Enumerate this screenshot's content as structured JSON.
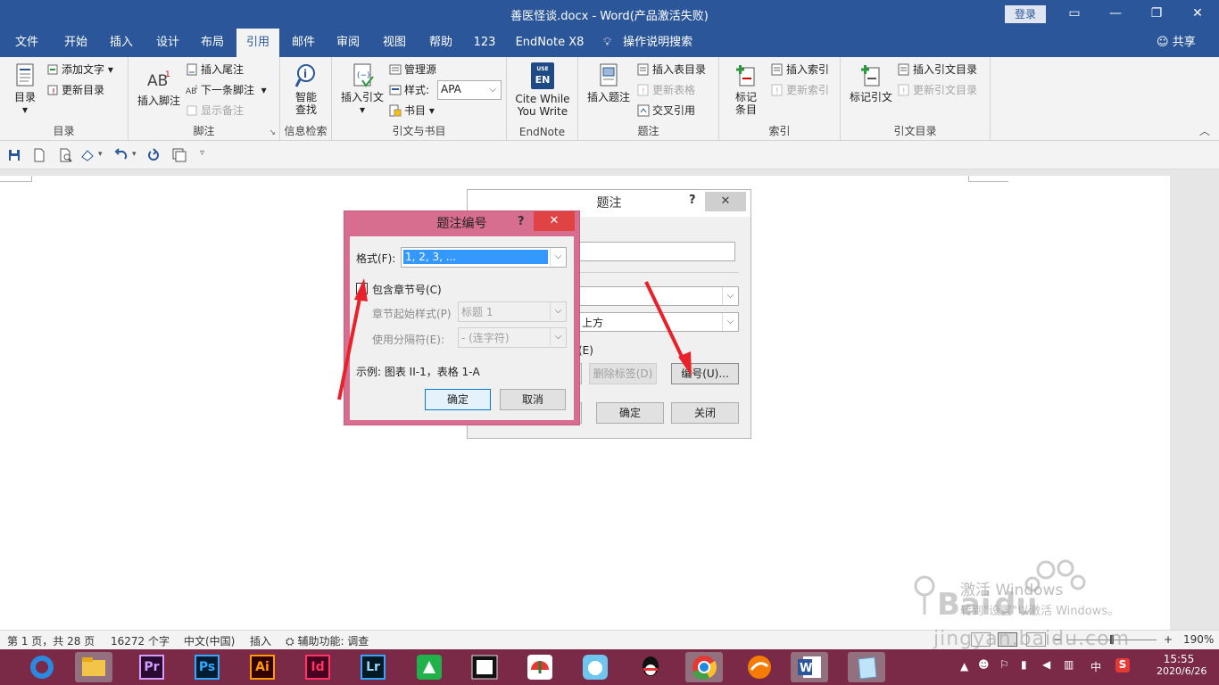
{
  "window": {
    "title": "善医怪谈.docx  -  Word(产品激活失败)",
    "login": "登录",
    "controls": {
      "ribbon_opts": "▭",
      "minimize": "—",
      "restore": "❐",
      "close": "✕"
    }
  },
  "tabs": [
    {
      "label": "文件"
    },
    {
      "label": "开始"
    },
    {
      "label": "插入"
    },
    {
      "label": "设计"
    },
    {
      "label": "布局"
    },
    {
      "label": "引用"
    },
    {
      "label": "邮件"
    },
    {
      "label": "审阅"
    },
    {
      "label": "视图"
    },
    {
      "label": "帮助"
    },
    {
      "label": "123"
    },
    {
      "label": "EndNote X8"
    },
    {
      "label": "操作说明搜索"
    }
  ],
  "share": "共享",
  "ribbon": {
    "toc": {
      "big": "目录",
      "add_text": "添加文字",
      "update": "更新目录",
      "label": "目录"
    },
    "footnote": {
      "big": "插入脚注",
      "endnote": "插入尾注",
      "next": "下一条脚注",
      "show": "显示备注",
      "label": "脚注"
    },
    "research": {
      "big1": "智能",
      "big2": "查找",
      "label": "信息检索"
    },
    "citations": {
      "big": "插入引文",
      "manage": "管理源",
      "style_label": "样式:",
      "style_value": "APA",
      "biblio": "书目",
      "label": "引文与书目"
    },
    "endnote": {
      "big1": "Cite While",
      "big2": "You Write",
      "label": "EndNote",
      "badge_top": "USE",
      "badge": "EN"
    },
    "captions": {
      "big": "插入题注",
      "table_of_figures": "插入表目录",
      "update_table": "更新表格",
      "cross_ref": "交叉引用",
      "label": "题注"
    },
    "index": {
      "big1": "标记",
      "big2": "条目",
      "insert": "插入索引",
      "update": "更新索引",
      "label": "索引"
    },
    "toa": {
      "big": "标记引文",
      "insert": "插入引文目录",
      "update": "更新引文目录",
      "label": "引文目录"
    }
  },
  "caption_dialog": {
    "title": "题注",
    "position_value": "上方",
    "option_suffix": "(E)",
    "delete_label": "删除标签(D)",
    "numbering": "编号(U)...",
    "ok": "确定",
    "close": "关闭"
  },
  "numbering_dialog": {
    "title": "题注编号",
    "format_label": "格式(F):",
    "format_value": "1, 2, 3, ...",
    "include_chapter": "包含章节号(C)",
    "chapter_style_label": "章节起始样式(P)",
    "chapter_style_value": "标题 1",
    "separator_label": "使用分隔符(E):",
    "separator_value": "-    (连字符)",
    "example": "示例: 图表 II-1，表格 1-A",
    "ok": "确定",
    "cancel": "取消"
  },
  "status": {
    "page": "第 1 页，共 28 页",
    "words": "16272 个字",
    "lang": "中文(中国)",
    "mode": "插入",
    "access": "辅助功能: 调查",
    "zoom": "190%"
  },
  "watermark": {
    "line1": "激活 Windows",
    "line2": "转到\"设置\"以激活 Windows。",
    "baidu": "jingyan.baidu.com"
  },
  "taskbar": {
    "apps": [
      "browser",
      "file-explorer",
      "premiere",
      "photoshop",
      "illustrator",
      "indesign",
      "lightroom",
      "green-app",
      "video-editor",
      "umbrella-app",
      "bird-app",
      "qq",
      "chrome",
      "foxmail",
      "word",
      "notepad"
    ],
    "ime": "中",
    "time": "15:55",
    "date": "2020/6/26"
  }
}
